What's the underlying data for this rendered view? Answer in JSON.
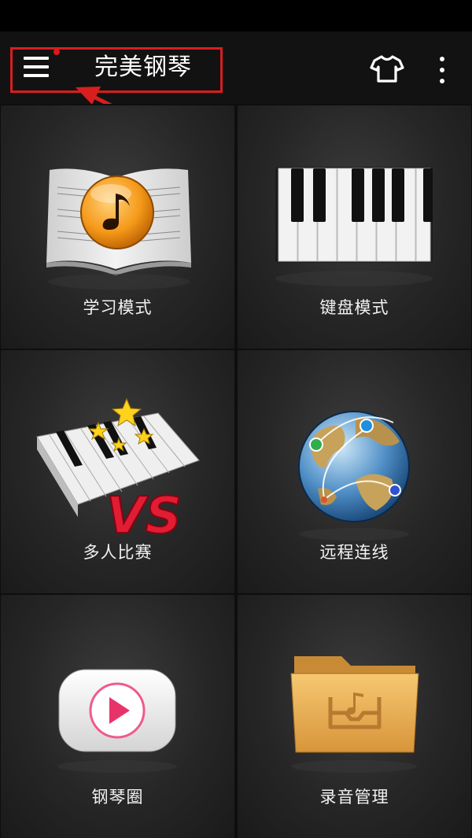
{
  "app_bar": {
    "title": "完美钢琴",
    "menu_icon": "hamburger-menu-icon",
    "theme_icon": "tshirt-icon",
    "overflow_icon": "more-vertical-icon",
    "notification_dot_color": "#e0161a"
  },
  "annotation": {
    "color": "#d81e1e"
  },
  "tiles": [
    {
      "label": "学习模式",
      "icon": "sheet-music-book-icon"
    },
    {
      "label": "键盘模式",
      "icon": "piano-keyboard-icon"
    },
    {
      "label": "多人比赛",
      "icon": "piano-vs-icon"
    },
    {
      "label": "远程连线",
      "icon": "globe-network-icon"
    },
    {
      "label": "钢琴圈",
      "icon": "video-play-icon"
    },
    {
      "label": "录音管理",
      "icon": "music-folder-icon"
    }
  ]
}
